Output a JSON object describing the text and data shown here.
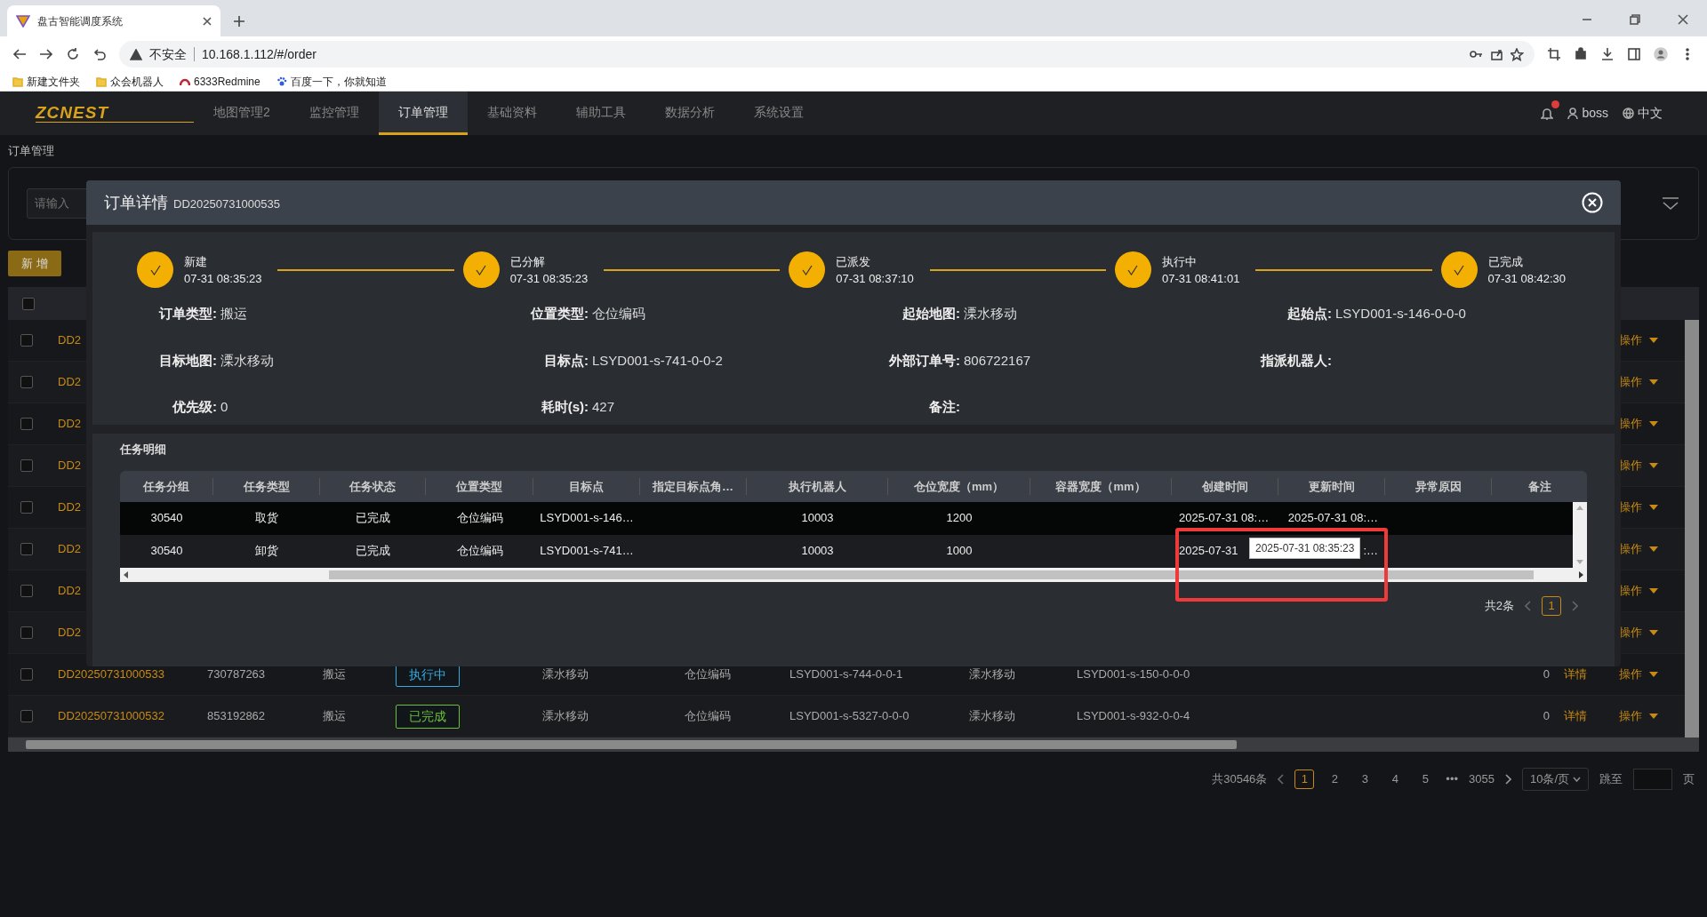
{
  "browser": {
    "tab_title": "盘古智能调度系统",
    "security": "不安全",
    "url": "10.168.1.112/#/order",
    "bookmarks": [
      {
        "label": "新建文件夹",
        "kind": "folder"
      },
      {
        "label": "众会机器人",
        "kind": "folder"
      },
      {
        "label": "6333Redmine",
        "kind": "redmine"
      },
      {
        "label": "百度一下，你就知道",
        "kind": "paw"
      }
    ]
  },
  "app": {
    "logo": "ZCNEST",
    "user": "boss",
    "language": "中文",
    "nav": [
      {
        "label": "地图管理2",
        "selected": false
      },
      {
        "label": "监控管理",
        "selected": false
      },
      {
        "label": "订单管理",
        "selected": true
      },
      {
        "label": "基础资料",
        "selected": false
      },
      {
        "label": "辅助工具",
        "selected": false
      },
      {
        "label": "数据分析",
        "selected": false
      },
      {
        "label": "系统设置",
        "selected": false
      }
    ]
  },
  "breadcrumb": "订单管理",
  "filter": {
    "placeholder": "请输入"
  },
  "add_button": "新 增",
  "orders": {
    "select_all_checked": false,
    "rows": [
      {
        "checked": false,
        "order_no": "DD2",
        "action": "操作"
      },
      {
        "checked": false,
        "order_no": "DD2",
        "action": "操作"
      },
      {
        "checked": false,
        "order_no": "DD2",
        "action": "操作"
      },
      {
        "checked": false,
        "order_no": "DD2",
        "action": "操作"
      },
      {
        "checked": false,
        "order_no": "DD2",
        "action": "操作"
      },
      {
        "checked": false,
        "order_no": "DD2",
        "action": "操作"
      },
      {
        "checked": false,
        "order_no": "DD2",
        "action": "操作"
      },
      {
        "checked": false,
        "order_no": "DD2",
        "action": "操作"
      },
      {
        "checked": false,
        "order_no": "DD20250731000533",
        "external_no": "730787263",
        "type": "搬运",
        "status": {
          "text": "执行中",
          "color": "#3aa9df"
        },
        "start_map": "溧水移动",
        "position_type": "仓位编码",
        "start_point": "LSYD001-s-744-0-0-1",
        "target_map": "溧水移动",
        "target_point": "LSYD001-s-150-0-0-0",
        "priority": "0",
        "detail": "详情",
        "action": "操作"
      },
      {
        "checked": false,
        "order_no": "DD20250731000532",
        "external_no": "853192862",
        "type": "搬运",
        "status": {
          "text": "已完成",
          "color": "#6cbf3a"
        },
        "start_map": "溧水移动",
        "position_type": "仓位编码",
        "start_point": "LSYD001-s-5327-0-0-0",
        "target_map": "溧水移动",
        "target_point": "LSYD001-s-932-0-0-4",
        "priority": "0",
        "detail": "详情",
        "action": "操作"
      }
    ]
  },
  "pagination": {
    "total": "共30546条",
    "pages": [
      {
        "label": "1",
        "selected": true
      },
      {
        "label": "2",
        "selected": false
      },
      {
        "label": "3",
        "selected": false
      },
      {
        "label": "4",
        "selected": false
      },
      {
        "label": "5",
        "selected": false
      }
    ],
    "ellipsis": "•••",
    "last": "3055",
    "page_size": "10条/页",
    "jump_label": "跳至",
    "page_suffix": "页"
  },
  "modal": {
    "title": "订单详情",
    "order_no": "DD20250731000535",
    "steps": [
      {
        "label": "新建",
        "time": "07-31 08:35:23",
        "done": true
      },
      {
        "label": "已分解",
        "time": "07-31 08:35:23",
        "done": true
      },
      {
        "label": "已派发",
        "time": "07-31 08:37:10",
        "done": true
      },
      {
        "label": "执行中",
        "time": "07-31 08:41:01",
        "done": true
      },
      {
        "label": "已完成",
        "time": "07-31 08:42:30",
        "done": true
      }
    ],
    "fields": [
      {
        "label": "订单类型:",
        "value": "搬运"
      },
      {
        "label": "位置类型:",
        "value": "仓位编码"
      },
      {
        "label": "起始地图:",
        "value": "溧水移动"
      },
      {
        "label": "起始点:",
        "value": "LSYD001-s-146-0-0-0"
      },
      {
        "label": "目标地图:",
        "value": "溧水移动"
      },
      {
        "label": "目标点:",
        "value": "LSYD001-s-741-0-0-2"
      },
      {
        "label": "外部订单号:",
        "value": "806722167"
      },
      {
        "label": "指派机器人:"
      },
      {
        "label": "优先级:",
        "value": "0"
      },
      {
        "label": "耗时(s):",
        "value": "427"
      },
      {
        "label": "备注:"
      }
    ],
    "tasks": {
      "title": "任务明细",
      "columns": [
        "任务分组",
        "任务类型",
        "任务状态",
        "位置类型",
        "目标点",
        "指定目标点角…",
        "执行机器人",
        "仓位宽度（mm）",
        "容器宽度（mm）",
        "创建时间",
        "更新时间",
        "异常原因",
        "备注"
      ],
      "rows": [
        [
          "30540",
          "取货",
          "已完成",
          "仓位编码",
          "LSYD001-s-146…",
          "",
          "10003",
          "1200",
          "",
          "2025-07-31 08:…",
          "2025-07-31 08:…",
          "",
          ""
        ],
        [
          "30540",
          "卸货",
          "已完成",
          "仓位编码",
          "LSYD001-s-741…",
          "",
          "10003",
          "1000",
          "",
          "2025-07-31",
          ":…",
          "",
          ""
        ]
      ],
      "tooltip": "2025-07-31 08:35:23",
      "total": "共2条",
      "pages": [
        {
          "label": "1",
          "selected": true
        }
      ]
    }
  }
}
